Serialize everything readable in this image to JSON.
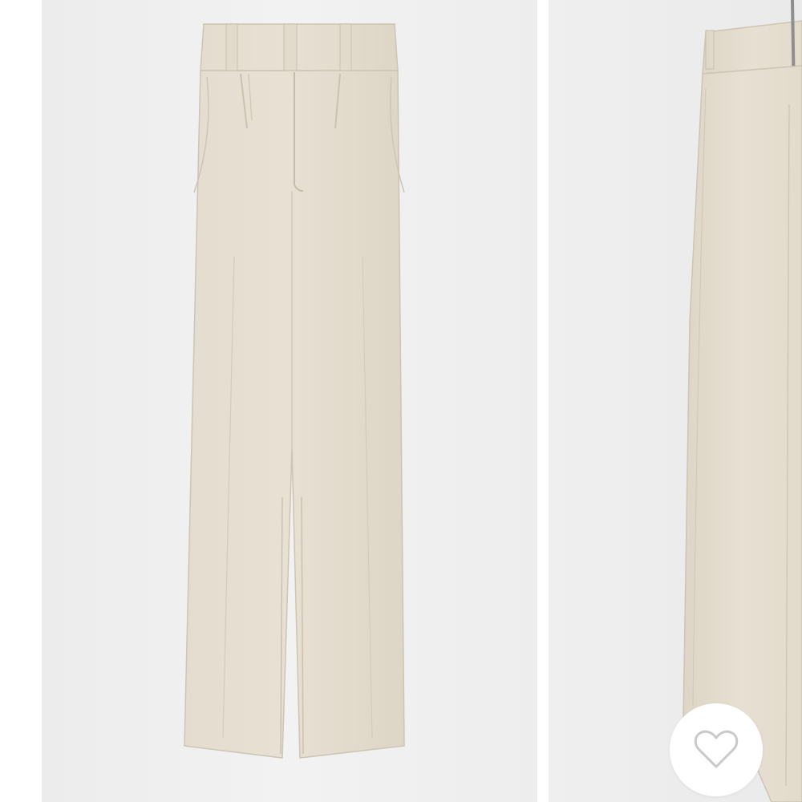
{
  "gallery": {
    "images": [
      {
        "alt": "",
        "icon": "pants-front-photo"
      },
      {
        "alt": "",
        "icon": "pants-side-photo"
      }
    ]
  },
  "favorite": {
    "icon": "heart-outline-icon"
  },
  "colors": {
    "photo_background": "#efefef",
    "fabric": "#e6dfd1",
    "fabric_shadow": "#cfc6b5",
    "heart_stroke": "#c9c9c9"
  }
}
